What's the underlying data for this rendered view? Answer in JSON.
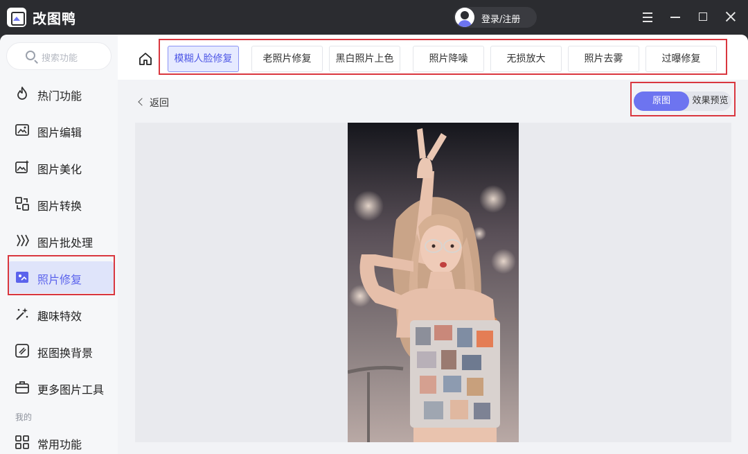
{
  "app": {
    "title": "改图鸭",
    "login_label": "登录/注册"
  },
  "sidebar": {
    "search_placeholder": "搜索功能",
    "items": [
      {
        "label": "热门功能",
        "icon": "flame-icon"
      },
      {
        "label": "图片编辑",
        "icon": "image-edit-icon"
      },
      {
        "label": "图片美化",
        "icon": "image-beautify-icon"
      },
      {
        "label": "图片转换",
        "icon": "convert-icon"
      },
      {
        "label": "图片批处理",
        "icon": "batch-icon"
      },
      {
        "label": "照片修复",
        "icon": "photo-repair-icon"
      },
      {
        "label": "趣味特效",
        "icon": "sparkle-icon"
      },
      {
        "label": "抠图换背景",
        "icon": "cutout-icon"
      },
      {
        "label": "更多图片工具",
        "icon": "toolbox-icon"
      }
    ],
    "active_index": 5,
    "section_label": "我的",
    "extra_items": [
      {
        "label": "常用功能",
        "icon": "grid-icon"
      }
    ]
  },
  "tabs": [
    "模糊人脸修复",
    "老照片修复",
    "黑白照片上色",
    "照片降噪",
    "无损放大",
    "照片去雾",
    "过曝修复"
  ],
  "active_tab": 0,
  "toolbar": {
    "back_label": "返回"
  },
  "toggle": {
    "original_label": "原图",
    "preview_label": "效果预览",
    "selected": "原图"
  },
  "colors": {
    "accent": "#6d74f0",
    "titlebar": "#2b2c30",
    "highlight_box": "#d9363e"
  }
}
